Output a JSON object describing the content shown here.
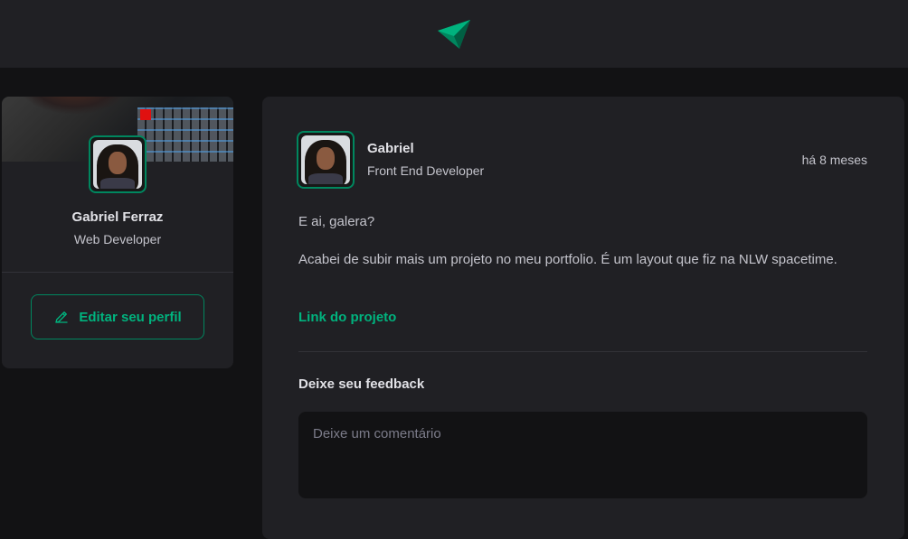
{
  "header": {
    "logo_icon": "ignite-feed-logo-icon"
  },
  "sidebar": {
    "cover_image": "keyboard-cover-image",
    "avatar_icon": "avatar-gabriel",
    "name": "Gabriel Ferraz",
    "role": "Web Developer",
    "edit_button": {
      "label": "Editar seu perfil",
      "icon": "pencil-icon"
    }
  },
  "post": {
    "author": {
      "name": "Gabriel",
      "role": "Front End Developer"
    },
    "time": "há 8 meses",
    "content": [
      "E ai, galera?",
      "Acabei de subir mais um projeto no meu portfolio. É um layout que fiz na NLW spacetime."
    ],
    "link": "Link do projeto",
    "feedback": {
      "title": "Deixe seu feedback",
      "placeholder": "Deixe um comentário"
    }
  },
  "colors": {
    "accent": "#00b37e",
    "accent_border": "#00875f",
    "background": "#121214",
    "card": "#202024"
  }
}
